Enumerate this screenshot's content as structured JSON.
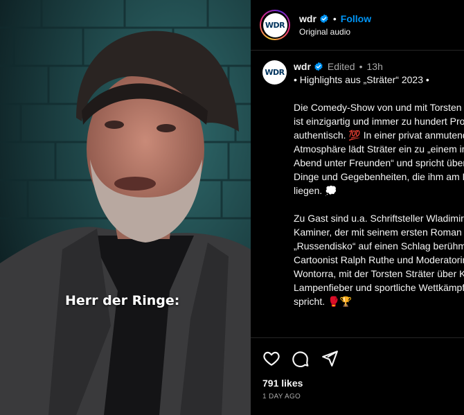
{
  "media": {
    "caption": "Herr der Ringe:"
  },
  "header": {
    "username": "wdr",
    "follow_label": "Follow",
    "dot": "•",
    "audio": "Original audio",
    "logo_text": "WDR"
  },
  "post": {
    "username": "wdr",
    "edited": "Edited",
    "dot": "•",
    "time": "13h",
    "title": "• Highlights aus „Sträter“ 2023 •",
    "paragraph1": "Die Comedy-Show von und mit Torsten Sträter ist einzigartig und immer zu hundert Prozent authentisch. 💯 In einer privat anmutenden Atmosphäre lädt Sträter ein zu „einem intimen Abend unter Freunden“ und spricht über die Dinge und Gegebenheiten, die ihm am Herzen liegen. 💭",
    "paragraph2": "Zu Gast sind u.a. Schriftsteller Wladimir Kaminer, der mit seinem ersten Roman „Russendisko“ auf einen Schlag berühmt wurde, Cartoonist Ralph Ruthe und Moderatorin Laura Wontorra, mit der Torsten Sträter über Karriere, Lampenfieber und sportliche Wettkämpfe spricht. 🥊🏆"
  },
  "footer": {
    "likes": "791 likes",
    "ago": "1 DAY AGO"
  },
  "icons": {
    "like": "heart-icon",
    "comment": "comment-icon",
    "share": "share-icon",
    "verified": "verified-badge-icon"
  },
  "colors": {
    "accent": "#0095f6",
    "muted": "#a8a8a8",
    "background": "#000000"
  }
}
